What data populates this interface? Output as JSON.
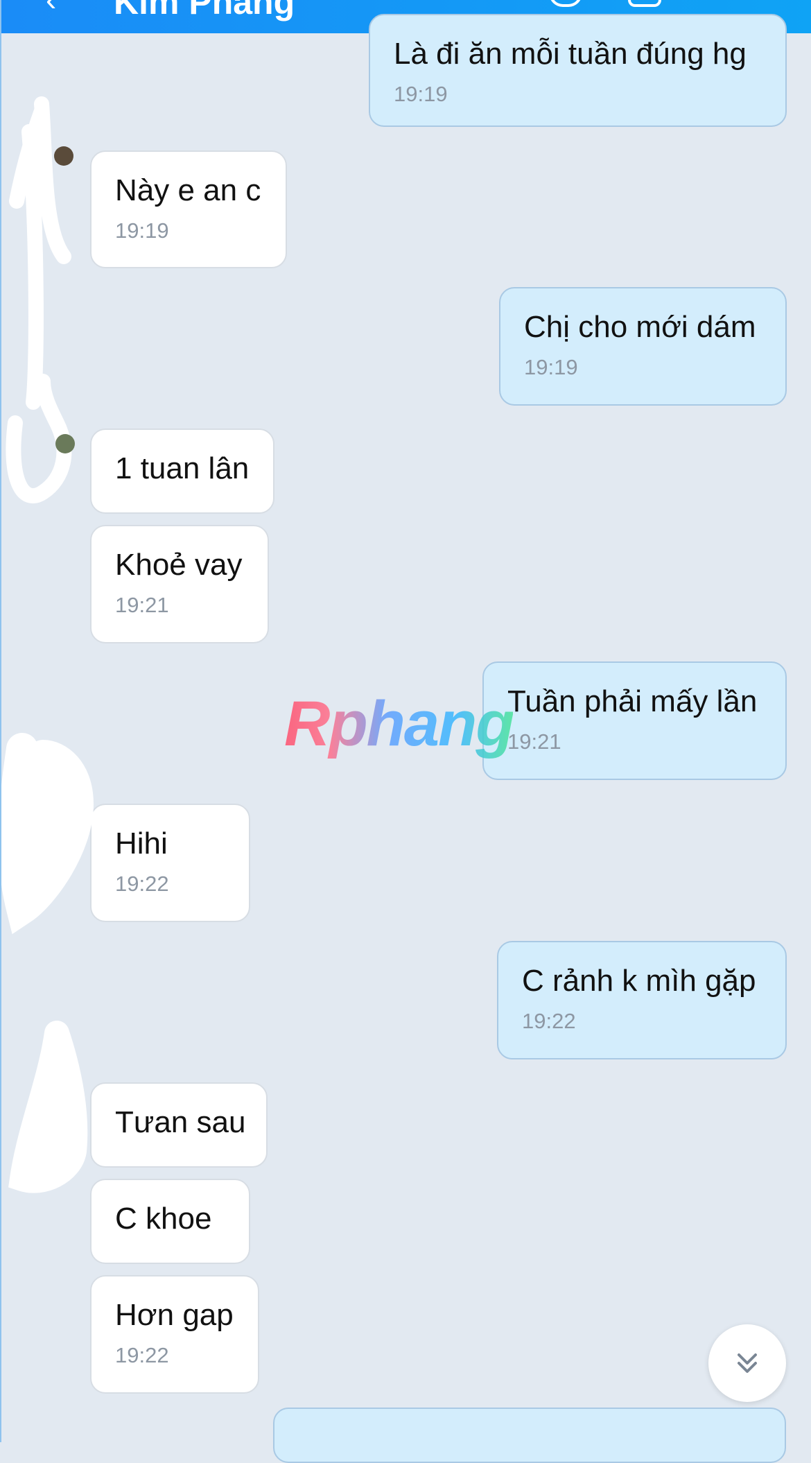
{
  "header": {
    "title": "Kim Phang",
    "back_icon": "chevron-left-icon",
    "call_icon": "phone-icon",
    "video_icon": "video-icon",
    "menu_icon": "menu-icon"
  },
  "messages": [
    {
      "dir": "out",
      "text": "Là đi ăn mỗi tuần đúng hg",
      "time": "19:19"
    },
    {
      "dir": "in",
      "text": "Này e an c",
      "time": "19:19"
    },
    {
      "dir": "out",
      "text": "Chị cho mới dám",
      "time": "19:19"
    },
    {
      "dir": "in",
      "text": "1 tuan lân",
      "time": ""
    },
    {
      "dir": "in",
      "text": "Khoẻ vay",
      "time": "19:21"
    },
    {
      "dir": "out",
      "text": "Tuần phải mấy lần",
      "time": "19:21"
    },
    {
      "dir": "in",
      "text": "Hihi",
      "time": "19:22"
    },
    {
      "dir": "out",
      "text": "C rảnh k mìh gặp",
      "time": "19:22"
    },
    {
      "dir": "in",
      "text": "Tưan sau",
      "time": ""
    },
    {
      "dir": "in",
      "text": "C khoe",
      "time": ""
    },
    {
      "dir": "in",
      "text": "Hơn gap",
      "time": "19:22"
    }
  ],
  "watermark": "Rphang",
  "scroll_button_icon": "double-chevron-down-icon",
  "colors": {
    "header": "#1a8cf7",
    "background": "#e2e9f1",
    "incoming_bubble": "#ffffff",
    "outgoing_bubble": "#d3edfc"
  }
}
